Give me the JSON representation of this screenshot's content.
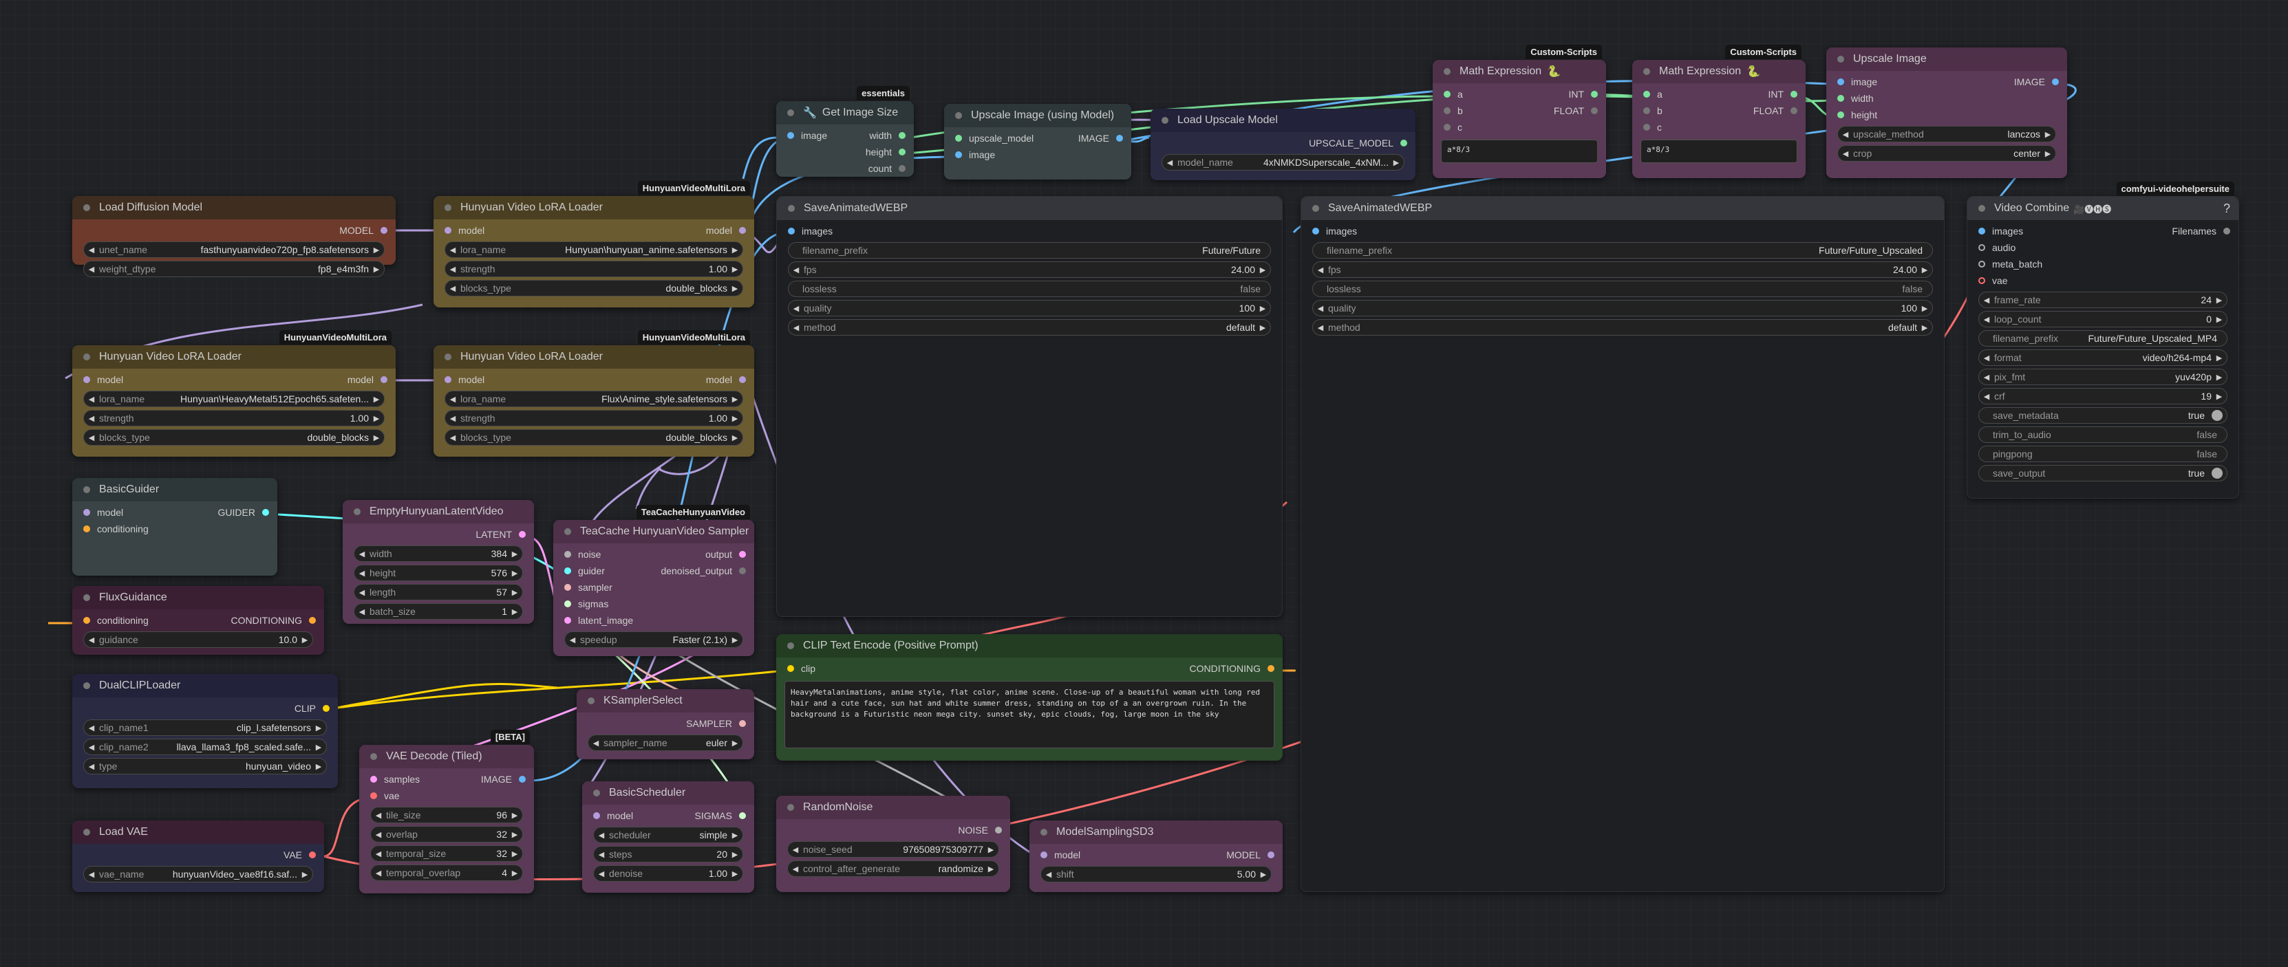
{
  "colors": {
    "image": "#64b5f6",
    "model": "#b39ddb",
    "clip": "#ffd500",
    "conditioning": "#ffa931",
    "latent": "#ff9cf9",
    "vae": "#ff6e6e",
    "int": "#29699c",
    "float": "#7ce29b",
    "guider": "#66ffff",
    "sampler": "#ecb4b4",
    "sigmas": "#cdffcd",
    "noise": "#b0b0b0"
  },
  "nodes": {
    "get_image_size": {
      "title": "Get Image Size",
      "badge": "essentials",
      "in": [
        "image"
      ],
      "out": [
        "width",
        "height",
        "count"
      ]
    },
    "upscale_model_node": {
      "title": "Upscale Image (using Model)",
      "in": [
        "upscale_model",
        "image"
      ],
      "out": [
        "IMAGE"
      ]
    },
    "load_upscale_model": {
      "title": "Load Upscale Model",
      "out": [
        "UPSCALE_MODEL"
      ],
      "w_model_name": {
        "label": "model_name",
        "value": "4xNMKDSuperscale_4xNM..."
      }
    },
    "math1": {
      "title": "Math Expression",
      "badge": "Custom-Scripts",
      "in": [
        "a",
        "b",
        "c"
      ],
      "out": [
        "INT",
        "FLOAT"
      ],
      "expr": "a*8/3"
    },
    "math2": {
      "title": "Math Expression",
      "badge": "Custom-Scripts",
      "in": [
        "a",
        "b",
        "c"
      ],
      "out": [
        "INT",
        "FLOAT"
      ],
      "expr": "a*8/3"
    },
    "upscale_image": {
      "title": "Upscale Image",
      "in": [
        "image",
        "width",
        "height"
      ],
      "out": [
        "IMAGE"
      ],
      "w_method": {
        "label": "upscale_method",
        "value": "lanczos"
      },
      "w_crop": {
        "label": "crop",
        "value": "center"
      }
    },
    "load_diffusion": {
      "title": "Load Diffusion Model",
      "out": [
        "MODEL"
      ],
      "w_unet": {
        "label": "unet_name",
        "value": "fasthunyuanvideo720p_fp8.safetensors"
      },
      "w_dtype": {
        "label": "weight_dtype",
        "value": "fp8_e4m3fn"
      }
    },
    "lora1": {
      "title": "Hunyuan Video LoRA Loader",
      "badge": "HunyuanVideoMultiLora",
      "in": [
        "model"
      ],
      "out": [
        "model"
      ],
      "w_lora": {
        "label": "lora_name",
        "value": "Hunyuan\\hunyuan_anime.safetensors"
      },
      "w_strength": {
        "label": "strength",
        "value": "1.00"
      },
      "w_blocks": {
        "label": "blocks_type",
        "value": "double_blocks"
      }
    },
    "lora2": {
      "title": "Hunyuan Video LoRA Loader",
      "badge": "HunyuanVideoMultiLora",
      "in": [
        "model"
      ],
      "out": [
        "model"
      ],
      "w_lora": {
        "label": "lora_name",
        "value": "Hunyuan\\HeavyMetal512Epoch65.safeten..."
      },
      "w_strength": {
        "label": "strength",
        "value": "1.00"
      },
      "w_blocks": {
        "label": "blocks_type",
        "value": "double_blocks"
      }
    },
    "lora3": {
      "title": "Hunyuan Video LoRA Loader",
      "badge": "HunyuanVideoMultiLora",
      "in": [
        "model"
      ],
      "out": [
        "model"
      ],
      "w_lora": {
        "label": "lora_name",
        "value": "Flux\\Anime_style.safetensors"
      },
      "w_strength": {
        "label": "strength",
        "value": "1.00"
      },
      "w_blocks": {
        "label": "blocks_type",
        "value": "double_blocks"
      }
    },
    "save_webp1": {
      "title": "SaveAnimatedWEBP",
      "in": [
        "images"
      ],
      "w_prefix": {
        "label": "filename_prefix",
        "value": "Future/Future"
      },
      "w_fps": {
        "label": "fps",
        "value": "24.00"
      },
      "w_lossless": {
        "label": "lossless",
        "value": "false"
      },
      "w_quality": {
        "label": "quality",
        "value": "100"
      },
      "w_method": {
        "label": "method",
        "value": "default"
      }
    },
    "save_webp2": {
      "title": "SaveAnimatedWEBP",
      "in": [
        "images"
      ],
      "w_prefix": {
        "label": "filename_prefix",
        "value": "Future/Future_Upscaled"
      },
      "w_fps": {
        "label": "fps",
        "value": "24.00"
      },
      "w_lossless": {
        "label": "lossless",
        "value": "false"
      },
      "w_quality": {
        "label": "quality",
        "value": "100"
      },
      "w_method": {
        "label": "method",
        "value": "default"
      }
    },
    "video_combine": {
      "title": "Video Combine",
      "title_icons": "🎥🅥🅗🅢",
      "help": "?",
      "badge": "comfyui-videohelpersuite",
      "in": [
        "images",
        "audio",
        "meta_batch",
        "vae"
      ],
      "out": [
        "Filenames"
      ],
      "w_frame_rate": {
        "label": "frame_rate",
        "value": "24"
      },
      "w_loop_count": {
        "label": "loop_count",
        "value": "0"
      },
      "w_prefix": {
        "label": "filename_prefix",
        "value": "Future/Future_Upscaled_MP4"
      },
      "w_format": {
        "label": "format",
        "value": "video/h264-mp4"
      },
      "w_pix_fmt": {
        "label": "pix_fmt",
        "value": "yuv420p"
      },
      "w_crf": {
        "label": "crf",
        "value": "19"
      },
      "w_save_metadata": {
        "label": "save_metadata",
        "value": "true"
      },
      "w_trim": {
        "label": "trim_to_audio",
        "value": "false"
      },
      "w_pingpong": {
        "label": "pingpong",
        "value": "false"
      },
      "w_save_output": {
        "label": "save_output",
        "value": "true"
      }
    },
    "basic_guider": {
      "title": "BasicGuider",
      "in": [
        "model",
        "conditioning"
      ],
      "out": [
        "GUIDER"
      ]
    },
    "empty_latent": {
      "title": "EmptyHunyuanLatentVideo",
      "out": [
        "LATENT"
      ],
      "w_width": {
        "label": "width",
        "value": "384"
      },
      "w_height": {
        "label": "height",
        "value": "576"
      },
      "w_length": {
        "label": "length",
        "value": "57"
      },
      "w_batch": {
        "label": "batch_size",
        "value": "1"
      }
    },
    "teacache": {
      "title": "TeaCache HunyuanVideo Sampler",
      "badge": "TeaCacheHunyuanVideo",
      "in": [
        "noise",
        "guider",
        "sampler",
        "sigmas",
        "latent_image"
      ],
      "out": [
        "output",
        "denoised_output"
      ],
      "w_speedup": {
        "label": "speedup",
        "value": "Faster (2.1x)"
      }
    },
    "flux_guidance": {
      "title": "FluxGuidance",
      "in": [
        "conditioning"
      ],
      "out": [
        "CONDITIONING"
      ],
      "w_guidance": {
        "label": "guidance",
        "value": "10.0"
      }
    },
    "clip_text": {
      "title": "CLIP Text Encode (Positive Prompt)",
      "in": [
        "clip"
      ],
      "out": [
        "CONDITIONING"
      ],
      "text": "HeavyMetalanimations, anime style, flat color, anime scene. Close-up of a beautiful woman with long red hair and a cute face, sun hat and white summer dress, standing on top of a an overgrown ruin. In the background is a Futuristic neon mega city. sunset sky, epic clouds, fog, large moon in the sky"
    },
    "dual_clip": {
      "title": "DualCLIPLoader",
      "out": [
        "CLIP"
      ],
      "w_clip1": {
        "label": "clip_name1",
        "value": "clip_l.safetensors"
      },
      "w_clip2": {
        "label": "clip_name2",
        "value": "llava_llama3_fp8_scaled.safe..."
      },
      "w_type": {
        "label": "type",
        "value": "hunyuan_video"
      }
    },
    "ksampler_select": {
      "title": "KSamplerSelect",
      "out": [
        "SAMPLER"
      ],
      "w_sampler": {
        "label": "sampler_name",
        "value": "euler"
      }
    },
    "vae_decode": {
      "title": "VAE Decode (Tiled)",
      "badge": "[BETA]",
      "in": [
        "samples",
        "vae"
      ],
      "out": [
        "IMAGE"
      ],
      "w_tile": {
        "label": "tile_size",
        "value": "96"
      },
      "w_overlap": {
        "label": "overlap",
        "value": "32"
      },
      "w_temporal_size": {
        "label": "temporal_size",
        "value": "32"
      },
      "w_temporal_overlap": {
        "label": "temporal_overlap",
        "value": "4"
      }
    },
    "basic_scheduler": {
      "title": "BasicScheduler",
      "in": [
        "model"
      ],
      "out": [
        "SIGMAS"
      ],
      "w_scheduler": {
        "label": "scheduler",
        "value": "simple"
      },
      "w_steps": {
        "label": "steps",
        "value": "20"
      },
      "w_denoise": {
        "label": "denoise",
        "value": "1.00"
      }
    },
    "random_noise": {
      "title": "RandomNoise",
      "out": [
        "NOISE"
      ],
      "w_seed": {
        "label": "noise_seed",
        "value": "976508975309777"
      },
      "w_control": {
        "label": "control_after_generate",
        "value": "randomize"
      }
    },
    "model_sampling": {
      "title": "ModelSamplingSD3",
      "in": [
        "model"
      ],
      "out": [
        "MODEL"
      ],
      "w_shift": {
        "label": "shift",
        "value": "5.00"
      }
    },
    "load_vae": {
      "title": "Load VAE",
      "out": [
        "VAE"
      ],
      "w_vae": {
        "label": "vae_name",
        "value": "hunyuanVideo_vae8f16.saf..."
      }
    }
  }
}
